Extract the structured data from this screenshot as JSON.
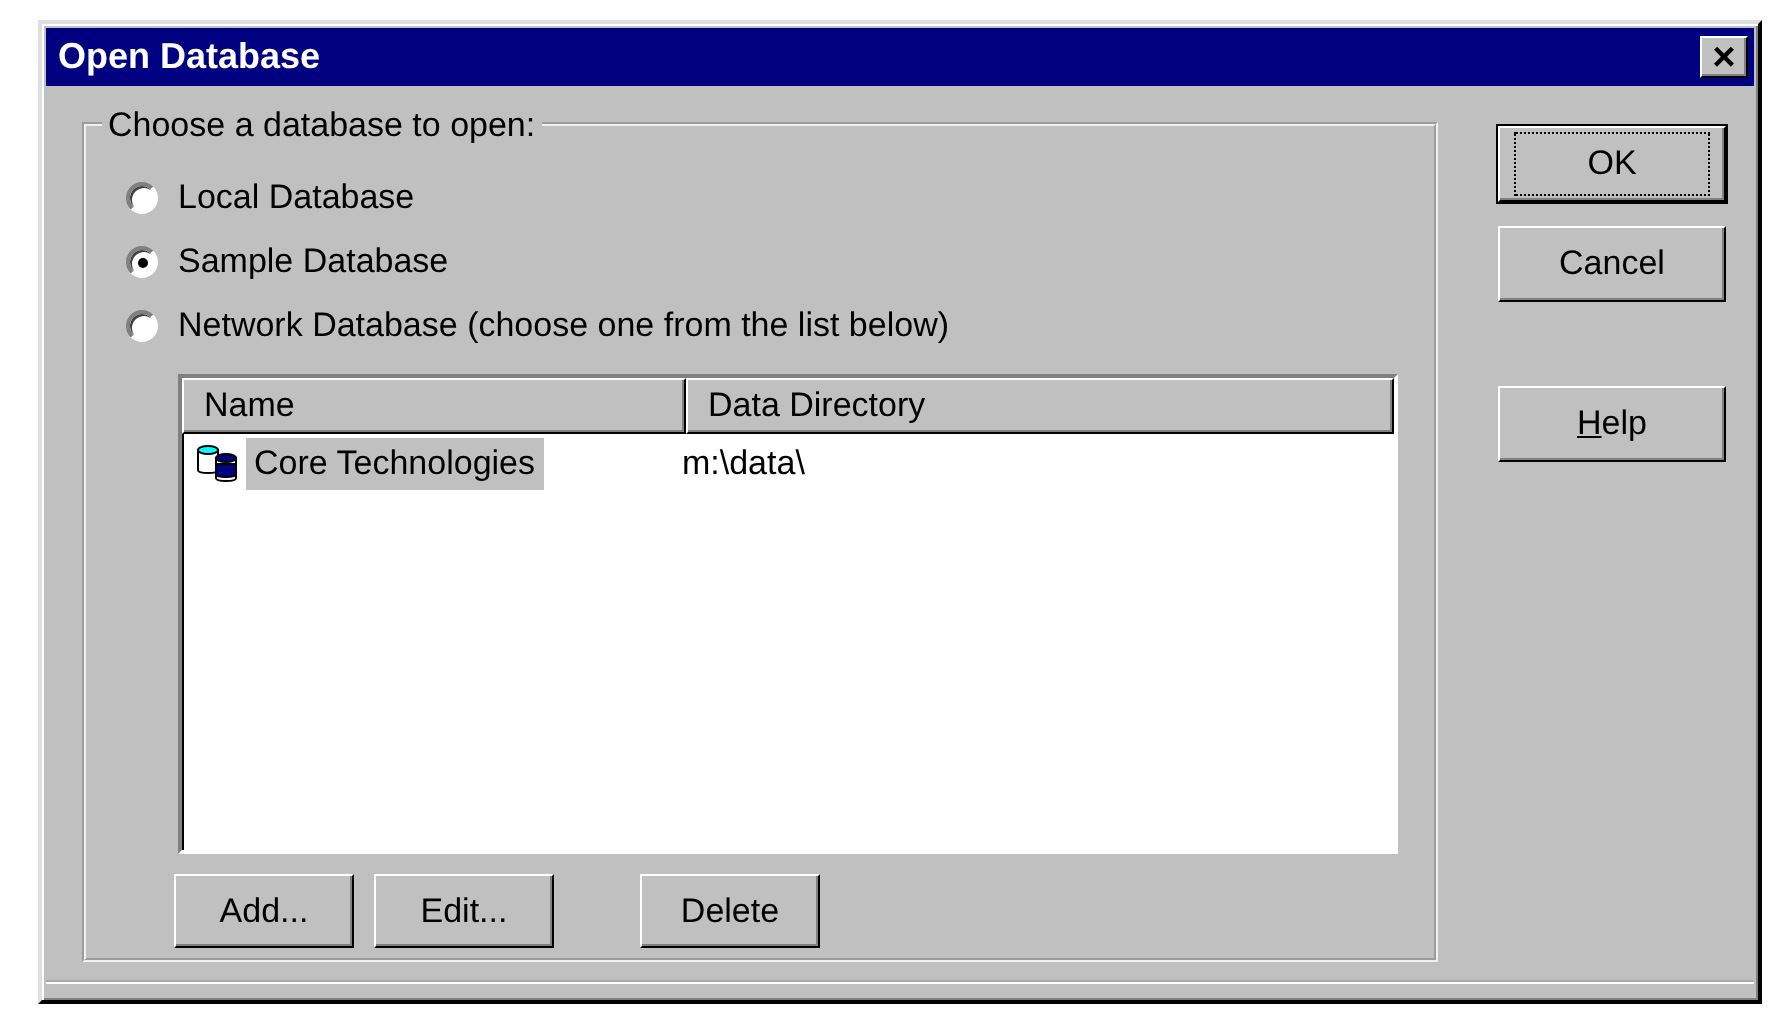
{
  "window": {
    "title": "Open Database",
    "close_glyph": "×"
  },
  "group": {
    "legend": "Choose a database to open:",
    "options": [
      {
        "label": "Local Database",
        "selected": false
      },
      {
        "label": "Sample Database",
        "selected": true
      },
      {
        "label": "Network Database (choose one from the list below)",
        "selected": false
      }
    ],
    "table": {
      "columns": [
        "Name",
        "Data Directory"
      ],
      "rows": [
        {
          "cells": [
            "Core Technologies",
            "m:\\data\\"
          ],
          "selected": true
        }
      ]
    },
    "button_groups": [
      [
        {
          "label": "Add..."
        },
        {
          "label": "Edit..."
        }
      ],
      [
        {
          "label": "Delete"
        }
      ]
    ]
  },
  "button_groups": [
    [
      {
        "label": "OK",
        "default": true,
        "underline_first": false
      },
      {
        "label": "Cancel",
        "default": false,
        "underline_first": false
      }
    ],
    [
      {
        "label": "Help",
        "default": false,
        "underline_first": true
      }
    ]
  ]
}
